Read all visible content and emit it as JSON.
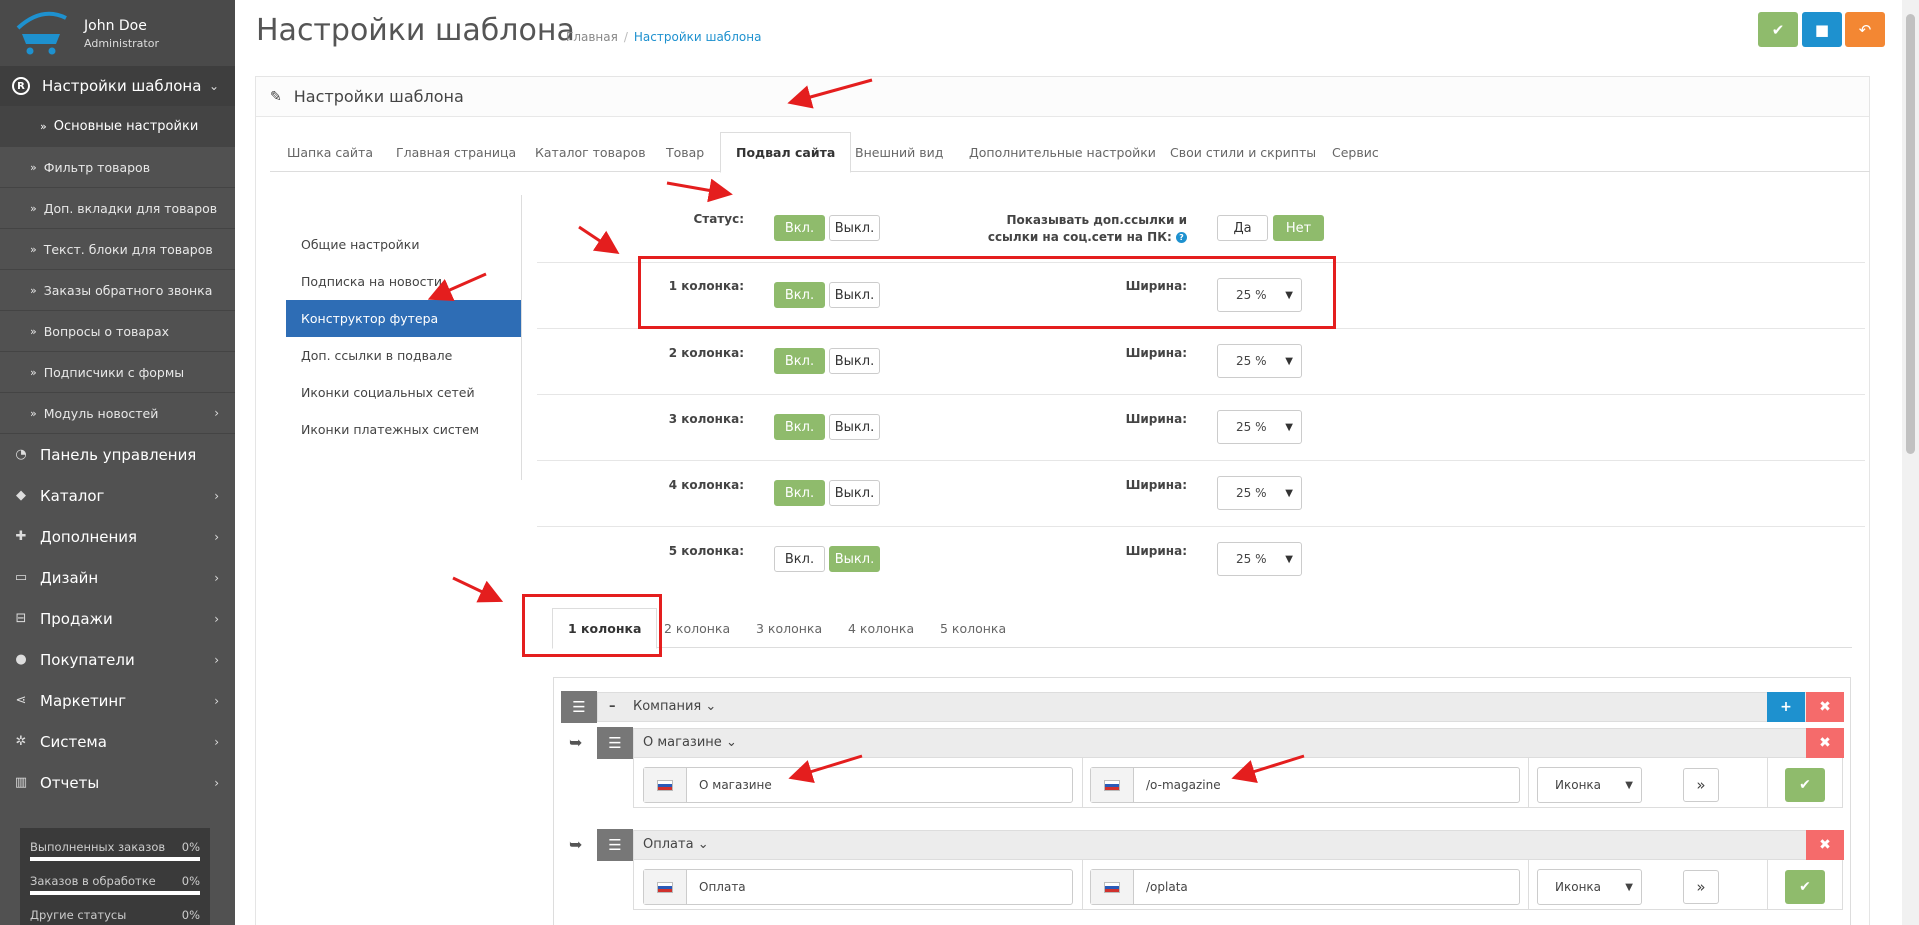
{
  "user": {
    "name": "John Doe",
    "role": "Administrator"
  },
  "sidebar": {
    "top_item": "Настройки шаблона",
    "sub_items": [
      "Основные настройки",
      "Фильтр товаров",
      "Доп. вкладки для товаров",
      "Текст. блоки для товаров",
      "Заказы обратного звонка",
      "Вопросы о товарах",
      "Подписчики с формы",
      "Модуль новостей"
    ],
    "main_items": [
      "Панель управления",
      "Каталог",
      "Дополнения",
      "Дизайн",
      "Продажи",
      "Покупатели",
      "Маркетинг",
      "Система",
      "Отчеты"
    ],
    "stats": [
      {
        "label": "Выполненных заказов",
        "value": "0%"
      },
      {
        "label": "Заказов в обработке",
        "value": "0%"
      },
      {
        "label": "Другие статусы",
        "value": "0%"
      }
    ]
  },
  "header": {
    "title": "Настройки шаблона",
    "breadcrumb_home": "Главная",
    "breadcrumb_sep": "/",
    "breadcrumb_current": "Настройки шаблона"
  },
  "panel": {
    "title": "Настройки шаблона"
  },
  "tabs": [
    "Шапка сайта",
    "Главная страница",
    "Каталог товаров",
    "Товар",
    "Подвал сайта",
    "Внешний вид",
    "Дополнительные настройки",
    "Свои стили и скрипты",
    "Сервис"
  ],
  "vnav": [
    "Общие настройки",
    "Подписка на новости",
    "Конструктор футера",
    "Доп. ссылки в подвале",
    "Иконки социальных сетей",
    "Иконки платежных систем"
  ],
  "settings": {
    "status_label": "Статус:",
    "on_label": "Вкл.",
    "off_label": "Выкл.",
    "show_links_label_1": "Показывать доп.ссылки и",
    "show_links_label_2": "ссылки на соц.сети на ПК:",
    "yes_label": "Да",
    "no_label": "Нет",
    "width_label": "Ширина:",
    "columns": [
      {
        "label": "1 колонка:",
        "width": "25 %"
      },
      {
        "label": "2 колонка:",
        "width": "25 %"
      },
      {
        "label": "3 колонка:",
        "width": "25 %"
      },
      {
        "label": "4 колонка:",
        "width": "25 %"
      },
      {
        "label": "5 колонка:",
        "width": "25 %"
      }
    ]
  },
  "column_tabs": [
    "1 колонка",
    "2 колонка",
    "3 колонка",
    "4 колонка",
    "5 колонка"
  ],
  "builder": {
    "group_title": "Компания",
    "items": [
      {
        "title": "О магазине",
        "name": "О магазине",
        "url": "/o-magazine",
        "icon": "Иконка"
      },
      {
        "title": "Оплата",
        "name": "Оплата",
        "url": "/oplata",
        "icon": "Иконка"
      }
    ]
  }
}
